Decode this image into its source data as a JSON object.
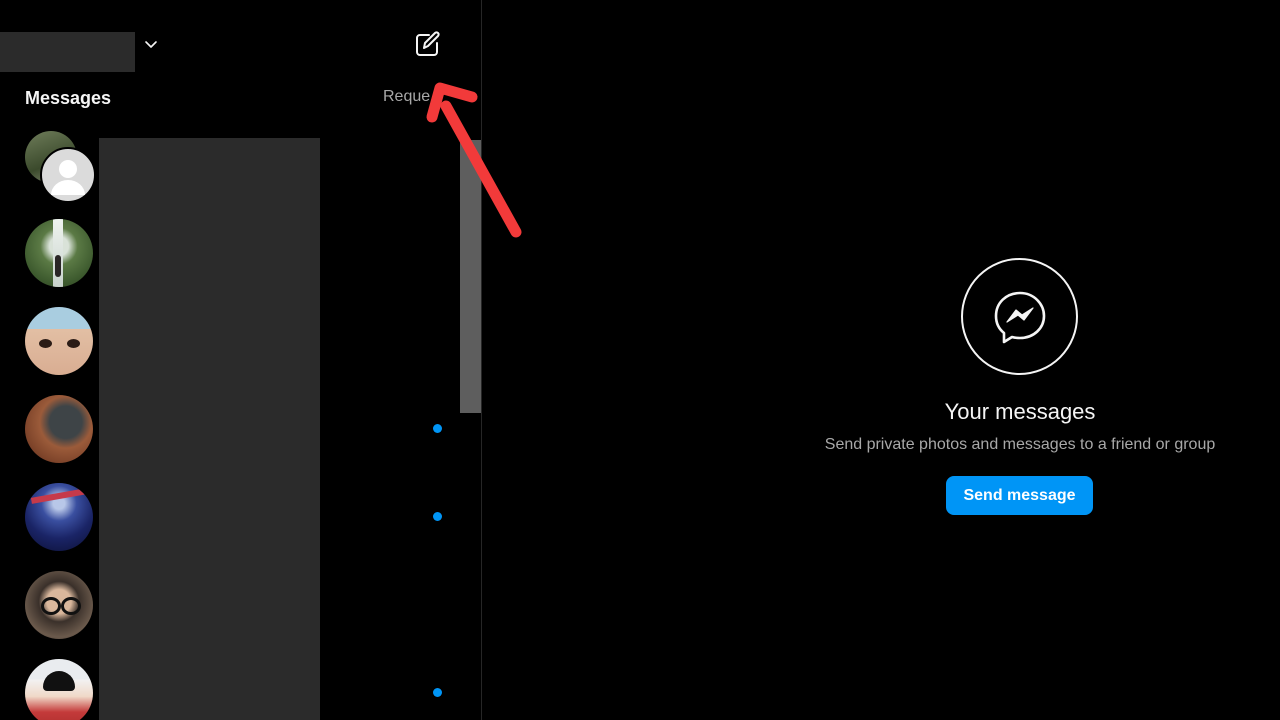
{
  "header": {
    "dropdown_icon": "chevron-down-icon",
    "compose_icon": "new-message-icon"
  },
  "sidebar": {
    "title": "Messages",
    "requests_label": "Reque",
    "conversations": [
      {
        "avatar": "group-avatar",
        "unread": false
      },
      {
        "avatar": "waterfall-photo-avatar",
        "unread": false
      },
      {
        "avatar": "closeup-face-avatar",
        "unread": false
      },
      {
        "avatar": "brown-tones-avatar",
        "unread": true
      },
      {
        "avatar": "night-lights-avatar",
        "unread": true
      },
      {
        "avatar": "glasses-portrait-avatar",
        "unread": false
      },
      {
        "avatar": "child-portrait-avatar",
        "unread": true
      }
    ]
  },
  "main": {
    "icon": "messenger-icon",
    "title": "Your messages",
    "subtitle": "Send private photos and messages to a friend or group",
    "button_label": "Send message"
  },
  "colors": {
    "background": "#000000",
    "accent": "#0095f6",
    "redaction": "#2b2b2b",
    "annotation": "#f23a3a"
  }
}
